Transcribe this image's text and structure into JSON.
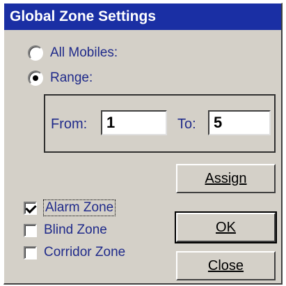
{
  "dialog": {
    "title": "Global Zone Settings"
  },
  "scope": {
    "options": [
      {
        "label": "All Mobiles:",
        "checked": false
      },
      {
        "label": "Range:",
        "checked": true
      }
    ]
  },
  "range": {
    "from_label": "From:",
    "from_value": "1",
    "to_label": "To:",
    "to_value": "5"
  },
  "buttons": {
    "assign_label": "Assign",
    "ok_label": "OK",
    "close_label": "Close"
  },
  "zones": [
    {
      "label": "Alarm Zone",
      "checked": true
    },
    {
      "label": "Blind Zone",
      "checked": false
    },
    {
      "label": "Corridor Zone",
      "checked": false
    }
  ]
}
